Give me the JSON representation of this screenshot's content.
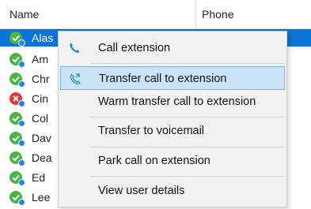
{
  "header": {
    "name": "Name",
    "phone": "Phone"
  },
  "rows": [
    {
      "name": "Alas",
      "status": "available"
    },
    {
      "name": "Am",
      "status": "available"
    },
    {
      "name": "Chr",
      "status": "available"
    },
    {
      "name": "Cin",
      "status": "offline"
    },
    {
      "name": "Col",
      "status": "available"
    },
    {
      "name": "Dav",
      "status": "available"
    },
    {
      "name": "Dea",
      "status": "available"
    },
    {
      "name": "Ed",
      "status": "available"
    },
    {
      "name": "Lee",
      "status": "available"
    }
  ],
  "menu": {
    "items": [
      {
        "label": "Call extension",
        "icon": "phone-icon"
      },
      {
        "label": "Transfer call to extension",
        "icon": "transfer-phone-icon",
        "highlighted": true
      },
      {
        "label": "Warm transfer call to extension"
      },
      {
        "label": "Transfer to voicemail"
      },
      {
        "label": "Park call on extension"
      },
      {
        "label": "View user details"
      }
    ]
  },
  "colors": {
    "selection": "#0a74d8",
    "available": "#4bb543",
    "offline": "#e53935",
    "menu_highlight": "#cce4f7",
    "icon_blue": "#1e88e5"
  }
}
